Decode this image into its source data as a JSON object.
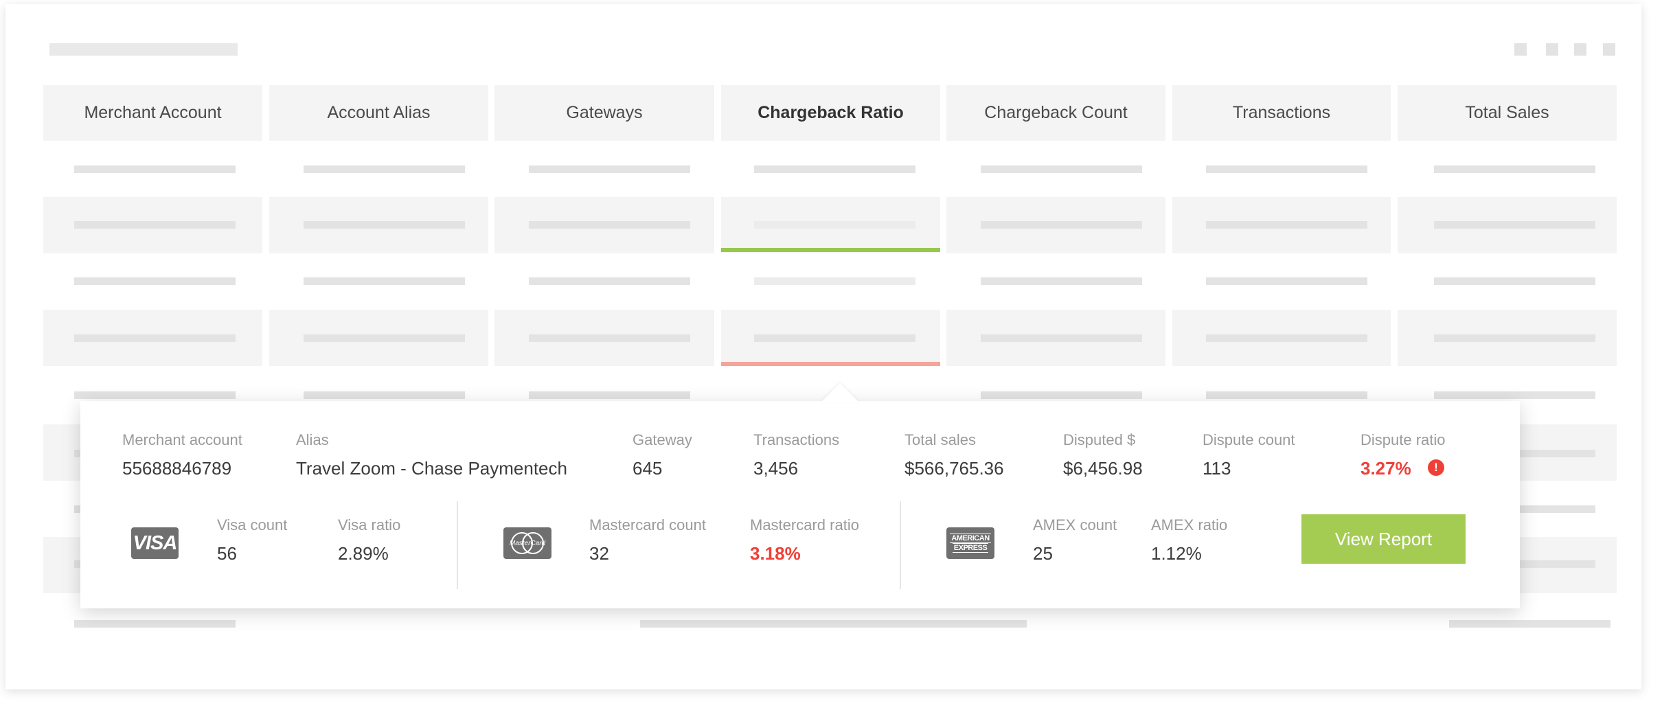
{
  "table": {
    "columns": [
      "Merchant Account",
      "Account Alias",
      "Gateways",
      "Chargeback Ratio",
      "Chargeback Count",
      "Transactions",
      "Total Sales"
    ]
  },
  "popover": {
    "merchant_account": {
      "label": "Merchant account",
      "value": "55688846789"
    },
    "alias": {
      "label": "Alias",
      "value": "Travel Zoom - Chase Paymentech"
    },
    "gateway": {
      "label": "Gateway",
      "value": "645"
    },
    "transactions": {
      "label": "Transactions",
      "value": "3,456"
    },
    "total_sales": {
      "label": "Total sales",
      "value": "$566,765.36"
    },
    "disputed": {
      "label": "Disputed $",
      "value": "$6,456.98"
    },
    "dispute_count": {
      "label": "Dispute count",
      "value": "113"
    },
    "dispute_ratio": {
      "label": "Dispute ratio",
      "value": "3.27%",
      "icon": "alert-icon",
      "icon_glyph": "!"
    },
    "visa": {
      "logo_text": "VISA",
      "count_label": "Visa count",
      "count": "56",
      "ratio_label": "Visa ratio",
      "ratio": "2.89%"
    },
    "mastercard": {
      "logo_text": "MasterCard",
      "count_label": "Mastercard count",
      "count": "32",
      "ratio_label": "Mastercard ratio",
      "ratio": "3.18%"
    },
    "amex": {
      "logo_line1": "AMERICAN",
      "logo_line2": "EXPRESS",
      "count_label": "AMEX count",
      "count": "25",
      "ratio_label": "AMEX ratio",
      "ratio": "1.12%"
    },
    "view_report_label": "View Report"
  },
  "colors": {
    "accent_green": "#a5cc52",
    "alert_red": "#ef4038",
    "good_indicator": "#98c84b",
    "bad_indicator": "#f4a49a"
  }
}
